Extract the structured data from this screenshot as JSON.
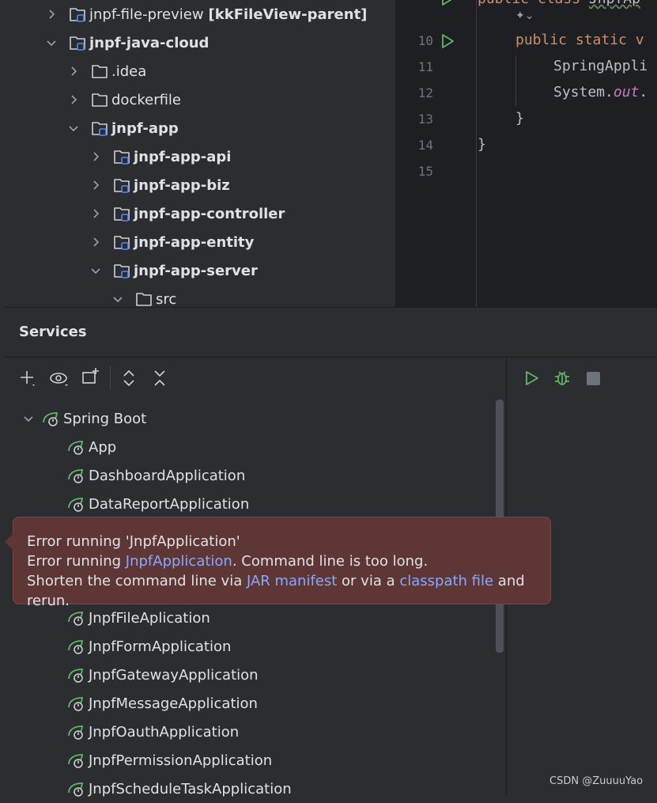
{
  "project_tree": {
    "items": [
      {
        "label": "jnpf-file-preview",
        "extra": "[kkFileView-parent]",
        "expanded": false,
        "bold": false,
        "module": true
      },
      {
        "label": "jnpf-java-cloud",
        "expanded": true,
        "bold": true,
        "module": true
      },
      {
        "label": ".idea",
        "expanded": false,
        "bold": false,
        "module": false
      },
      {
        "label": "dockerfile",
        "expanded": false,
        "bold": false,
        "module": false
      },
      {
        "label": "jnpf-app",
        "expanded": true,
        "bold": true,
        "module": true
      },
      {
        "label": "jnpf-app-api",
        "expanded": false,
        "bold": true,
        "module": true
      },
      {
        "label": "jnpf-app-biz",
        "expanded": false,
        "bold": true,
        "module": true
      },
      {
        "label": "jnpf-app-controller",
        "expanded": false,
        "bold": true,
        "module": true
      },
      {
        "label": "jnpf-app-entity",
        "expanded": false,
        "bold": true,
        "module": true
      },
      {
        "label": "jnpf-app-server",
        "expanded": true,
        "bold": true,
        "module": true
      },
      {
        "label": "src",
        "expanded": true,
        "bold": false,
        "module": false
      }
    ]
  },
  "editor": {
    "top_line": "public class JnpfAp",
    "line_numbers": [
      "10",
      "11",
      "12",
      "13",
      "14",
      "15"
    ],
    "lines": [
      {
        "kw": "public static v",
        "text": ""
      },
      {
        "kw": "",
        "text": "SpringAppli"
      },
      {
        "kw": "",
        "text": "System.",
        "field": "out",
        "after": "."
      },
      {
        "kw": "",
        "text": "}"
      },
      {
        "kw": "",
        "text": "}"
      },
      {
        "kw": "",
        "text": ""
      }
    ]
  },
  "services": {
    "title": "Services",
    "group": "Spring Boot",
    "apps_before_popup": [
      "App",
      "DashboardApplication",
      "DataReportApplication"
    ],
    "apps_after_popup": [
      "JnpfFileAplication",
      "JnpfFormApplication",
      "JnpfGatewayApplication",
      "JnpfMessageApplication",
      "JnpfOauthApplication",
      "JnpfPermissionApplication",
      "JnpfScheduleTaskApplication"
    ]
  },
  "popup": {
    "line1": "Error running 'JnpfApplication'",
    "line2_prefix": "Error running ",
    "line2_link": "JnpfApplication",
    "line2_suffix": ". Command line is too long.",
    "line3_prefix": "Shorten the command line via ",
    "line3_link1": "JAR manifest",
    "line3_mid": " or via a ",
    "line3_link2": "classpath file",
    "line3_suffix": " and rerun."
  },
  "watermark": "CSDN @ZuuuuYao",
  "colors": {
    "run": "#5fb865",
    "spring": "#5fb865",
    "link": "#88a8ff",
    "error_bg": "#5e3636"
  }
}
